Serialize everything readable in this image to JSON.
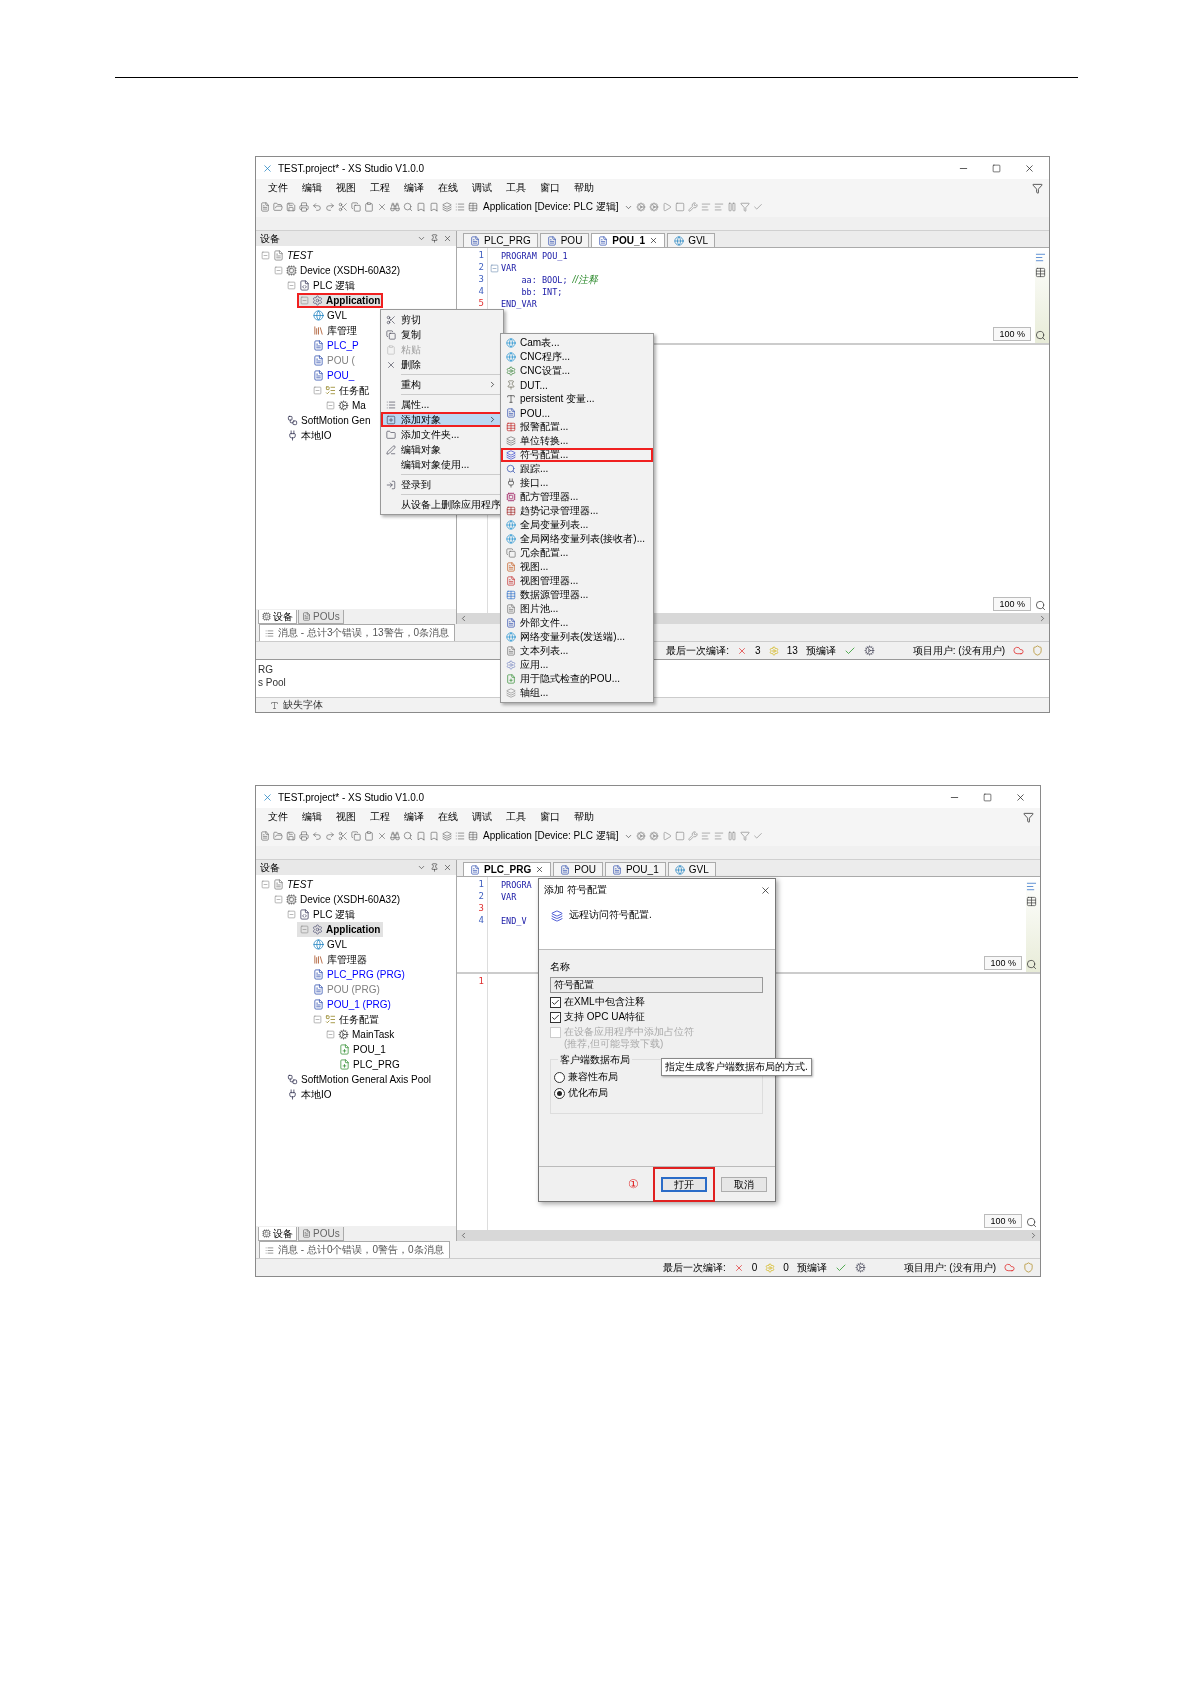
{
  "screenshots": [
    {
      "title": "TEST.project* - XS Studio V1.0.0",
      "menu": [
        "文件",
        "编辑",
        "视图",
        "工程",
        "编译",
        "在线",
        "调试",
        "工具",
        "窗口",
        "帮助"
      ],
      "toolbar_target": "Application [Device: PLC 逻辑]",
      "panel_title": "设备",
      "tree": [
        {
          "label": "TEST",
          "kind": "project",
          "selected": false,
          "annotated": false,
          "expanded": true,
          "children": [
            {
              "label": "Device (XSDH-60A32)",
              "kind": "device",
              "selected": false,
              "annotated": false,
              "expanded": true,
              "children": [
                {
                  "label": "PLC 逻辑",
                  "kind": "plc",
                  "selected": false,
                  "annotated": false,
                  "expanded": true,
                  "children": [
                    {
                      "label": "Application",
                      "kind": "app",
                      "selected": true,
                      "annotated": true,
                      "expanded": true,
                      "children": [
                        {
                          "label": "GVL",
                          "kind": "gvl",
                          "selected": false,
                          "annotated": false
                        },
                        {
                          "label": "库管理",
                          "kind": "lib",
                          "selected": false,
                          "annotated": false
                        },
                        {
                          "label": "PLC_P",
                          "kind": "pou",
                          "color": "#0000ff",
                          "selected": false,
                          "annotated": false
                        },
                        {
                          "label": "POU (",
                          "kind": "pou",
                          "color": "#808080",
                          "selected": false,
                          "annotated": false
                        },
                        {
                          "label": "POU_",
                          "kind": "pou",
                          "color": "#0000ff",
                          "selected": false,
                          "annotated": false
                        },
                        {
                          "label": "任务配",
                          "kind": "task",
                          "selected": false,
                          "annotated": false,
                          "expanded": true,
                          "children": [
                            {
                              "label": "Ma",
                              "kind": "maintask",
                              "selected": false,
                              "annotated": false,
                              "expanded": true
                            }
                          ]
                        }
                      ]
                    }
                  ]
                },
                {
                  "label": "SoftMotion Gen",
                  "kind": "motion",
                  "selected": false,
                  "annotated": false
                },
                {
                  "label": "本地IO",
                  "kind": "io",
                  "selected": false,
                  "annotated": false
                }
              ]
            }
          ]
        }
      ],
      "tabs": [
        {
          "label": "PLC_PRG",
          "selected": false
        },
        {
          "label": "POU",
          "selected": false
        },
        {
          "label": "POU_1",
          "selected": true
        },
        {
          "label": "GVL",
          "selected": false
        }
      ],
      "code_lines": [
        {
          "number": "1",
          "text": "PROGRAM POU_1",
          "modified": false
        },
        {
          "number": "2",
          "text": "VAR",
          "modified": false,
          "foldable": true
        },
        {
          "number": "3",
          "text": "    aa: BOOL;",
          "comment": "//注释",
          "modified": false
        },
        {
          "number": "4",
          "text": "    bb: INT;",
          "modified": false
        },
        {
          "number": "5",
          "text": "END_VAR",
          "modified": true
        }
      ],
      "zoom_upper": "100 %",
      "zoom_lower": "100 %",
      "panel_tabs": [
        {
          "label": "设备",
          "selected": true
        },
        {
          "label": "POUs",
          "selected": false
        }
      ],
      "messages": "消息 - 总计3个错误，13警告，0条消息",
      "status": {
        "last_build": "最后一次编译:",
        "errors": "3",
        "warnings": "13",
        "precompile": "预编译",
        "user": "项目用户: (没有用户)"
      },
      "context_menu": [
        {
          "kind": "item",
          "label": "剪切",
          "disabled": false,
          "selected": false,
          "annotated": false,
          "submenu": false
        },
        {
          "kind": "item",
          "label": "复制",
          "disabled": false,
          "selected": false,
          "annotated": false,
          "submenu": false
        },
        {
          "kind": "item",
          "label": "粘贴",
          "disabled": true,
          "selected": false,
          "annotated": false,
          "submenu": false
        },
        {
          "kind": "item",
          "label": "删除",
          "disabled": false,
          "selected": false,
          "annotated": false,
          "submenu": false
        },
        {
          "kind": "separator"
        },
        {
          "kind": "item",
          "label": "重构",
          "disabled": false,
          "selected": false,
          "annotated": false,
          "submenu": true
        },
        {
          "kind": "separator"
        },
        {
          "kind": "item",
          "label": "属性...",
          "disabled": false,
          "selected": false,
          "annotated": false,
          "submenu": false
        },
        {
          "kind": "item",
          "label": "添加对象",
          "disabled": false,
          "selected": true,
          "annotated": true,
          "submenu": true
        },
        {
          "kind": "item",
          "label": "添加文件夹...",
          "disabled": false,
          "selected": false,
          "annotated": false,
          "submenu": false
        },
        {
          "kind": "item",
          "label": "编辑对象",
          "disabled": false,
          "selected": false,
          "annotated": false,
          "submenu": false
        },
        {
          "kind": "item",
          "label": "编辑对象使用...",
          "disabled": false,
          "selected": false,
          "annotated": false,
          "submenu": false
        },
        {
          "kind": "separator"
        },
        {
          "kind": "item",
          "label": "登录到",
          "disabled": false,
          "selected": false,
          "annotated": false,
          "submenu": false
        },
        {
          "kind": "separator"
        },
        {
          "kind": "item",
          "label": "从设备上删除应用程序",
          "disabled": false,
          "selected": false,
          "annotated": false,
          "submenu": false
        }
      ],
      "submenu": [
        {
          "label": "Cam表...",
          "annotated": false
        },
        {
          "label": "CNC程序...",
          "annotated": false
        },
        {
          "label": "CNC设置...",
          "annotated": false
        },
        {
          "label": "DUT...",
          "annotated": false
        },
        {
          "label": "persistent 变量...",
          "annotated": false
        },
        {
          "label": "POU...",
          "annotated": false
        },
        {
          "label": "报警配置...",
          "annotated": false
        },
        {
          "label": "单位转换...",
          "annotated": false
        },
        {
          "label": "符号配置...",
          "annotated": true
        },
        {
          "label": "跟踪...",
          "annotated": false
        },
        {
          "label": "接口...",
          "annotated": false
        },
        {
          "label": "配方管理器...",
          "annotated": false
        },
        {
          "label": "趋势记录管理器...",
          "annotated": false
        },
        {
          "label": "全局变量列表...",
          "annotated": false
        },
        {
          "label": "全局网络变量列表(接收者)...",
          "annotated": false
        },
        {
          "label": "冗余配置...",
          "annotated": false
        },
        {
          "label": "视图...",
          "annotated": false
        },
        {
          "label": "视图管理器...",
          "annotated": false
        },
        {
          "label": "数据源管理器...",
          "annotated": false
        },
        {
          "label": "图片池...",
          "annotated": false
        },
        {
          "label": "外部文件...",
          "annotated": false
        },
        {
          "label": "网络变量列表(发送端)...",
          "annotated": false
        },
        {
          "label": "文本列表...",
          "annotated": false
        },
        {
          "label": "应用...",
          "annotated": false
        },
        {
          "label": "用于隐式检查的POU...",
          "annotated": false
        },
        {
          "label": "轴组...",
          "annotated": false
        }
      ],
      "background_window": {
        "lines": [
          "RG",
          "s Pool"
        ],
        "footer": "缺失字体"
      }
    },
    {
      "title": "TEST.project* - XS Studio V1.0.0",
      "menu": [
        "文件",
        "编辑",
        "视图",
        "工程",
        "编译",
        "在线",
        "调试",
        "工具",
        "窗口",
        "帮助"
      ],
      "toolbar_target": "Application [Device: PLC 逻辑]",
      "panel_title": "设备",
      "tree": [
        {
          "label": "TEST",
          "kind": "project",
          "selected": false,
          "annotated": false,
          "expanded": true,
          "children": [
            {
              "label": "Device (XSDH-60A32)",
              "kind": "device",
              "selected": false,
              "annotated": false,
              "expanded": true,
              "children": [
                {
                  "label": "PLC 逻辑",
                  "kind": "plc",
                  "selected": false,
                  "annotated": false,
                  "expanded": true,
                  "children": [
                    {
                      "label": "Application",
                      "kind": "app",
                      "selected": true,
                      "annotated": false,
                      "expanded": true,
                      "children": [
                        {
                          "label": "GVL",
                          "kind": "gvl",
                          "selected": false,
                          "annotated": false
                        },
                        {
                          "label": "库管理器",
                          "kind": "lib",
                          "selected": false,
                          "annotated": false
                        },
                        {
                          "label": "PLC_PRG (PRG)",
                          "kind": "pou",
                          "color": "#0000ff",
                          "selected": false,
                          "annotated": false
                        },
                        {
                          "label": "POU (PRG)",
                          "kind": "pou",
                          "color": "#808080",
                          "selected": false,
                          "annotated": false
                        },
                        {
                          "label": "POU_1 (PRG)",
                          "kind": "pou",
                          "color": "#0000ff",
                          "selected": false,
                          "annotated": false
                        },
                        {
                          "label": "任务配置",
                          "kind": "task",
                          "selected": false,
                          "annotated": false,
                          "expanded": true,
                          "children": [
                            {
                              "label": "MainTask",
                              "kind": "maintask",
                              "selected": false,
                              "annotated": false,
                              "expanded": true,
                              "children": [
                                {
                                  "label": "POU_1",
                                  "kind": "call",
                                  "selected": false,
                                  "annotated": false
                                },
                                {
                                  "label": "PLC_PRG",
                                  "kind": "call",
                                  "selected": false,
                                  "annotated": false
                                }
                              ]
                            }
                          ]
                        }
                      ]
                    }
                  ]
                },
                {
                  "label": "SoftMotion General Axis Pool",
                  "kind": "motion",
                  "selected": false,
                  "annotated": false
                },
                {
                  "label": "本地IO",
                  "kind": "io",
                  "selected": false,
                  "annotated": false
                }
              ]
            }
          ]
        }
      ],
      "tabs": [
        {
          "label": "PLC_PRG",
          "selected": true
        },
        {
          "label": "POU",
          "selected": false
        },
        {
          "label": "POU_1",
          "selected": false
        },
        {
          "label": "GVL",
          "selected": false
        }
      ],
      "code_lines": [
        {
          "number": "1",
          "text": "PROGRA",
          "modified": false
        },
        {
          "number": "2",
          "text": "VAR",
          "modified": false
        },
        {
          "number": "3",
          "modified": true
        },
        {
          "number": "4",
          "text": "END_V",
          "modified": false
        }
      ],
      "lower_lines": [
        {
          "number": "1",
          "modified": true
        }
      ],
      "zoom_upper": "100 %",
      "zoom_lower": "100 %",
      "panel_tabs": [
        {
          "label": "设备",
          "selected": true
        },
        {
          "label": "POUs",
          "selected": false
        }
      ],
      "messages": "消息 - 总计0个错误，0警告，0条消息",
      "status": {
        "last_build": "最后一次编译:",
        "errors": "0",
        "warnings": "0",
        "precompile": "预编译",
        "user": "项目用户: (没有用户)"
      },
      "dialog": {
        "title": "添加 符号配置",
        "description": "远程访问符号配置.",
        "name_label": "名称",
        "name_value": "符号配置",
        "options": [
          {
            "label": "在XML中包含注释",
            "checked": true,
            "disabled": false
          },
          {
            "label": "支持 OPC UA特征",
            "checked": true,
            "disabled": false
          },
          {
            "label": "在设备应用程序中添加占位符\n(推荐,但可能导致下载)",
            "checked": false,
            "disabled": true
          }
        ],
        "group_title": "客户端数据布局",
        "layouts": [
          {
            "label": "兼容性布局",
            "selected": false
          },
          {
            "label": "优化布局",
            "selected": true
          }
        ],
        "tooltip": "指定生成客户端数据布局的方式.",
        "step_marker": "①",
        "buttons": [
          {
            "label": "打开",
            "default": true,
            "annotated": true
          },
          {
            "label": "取消",
            "default": false,
            "annotated": false
          }
        ]
      }
    }
  ]
}
